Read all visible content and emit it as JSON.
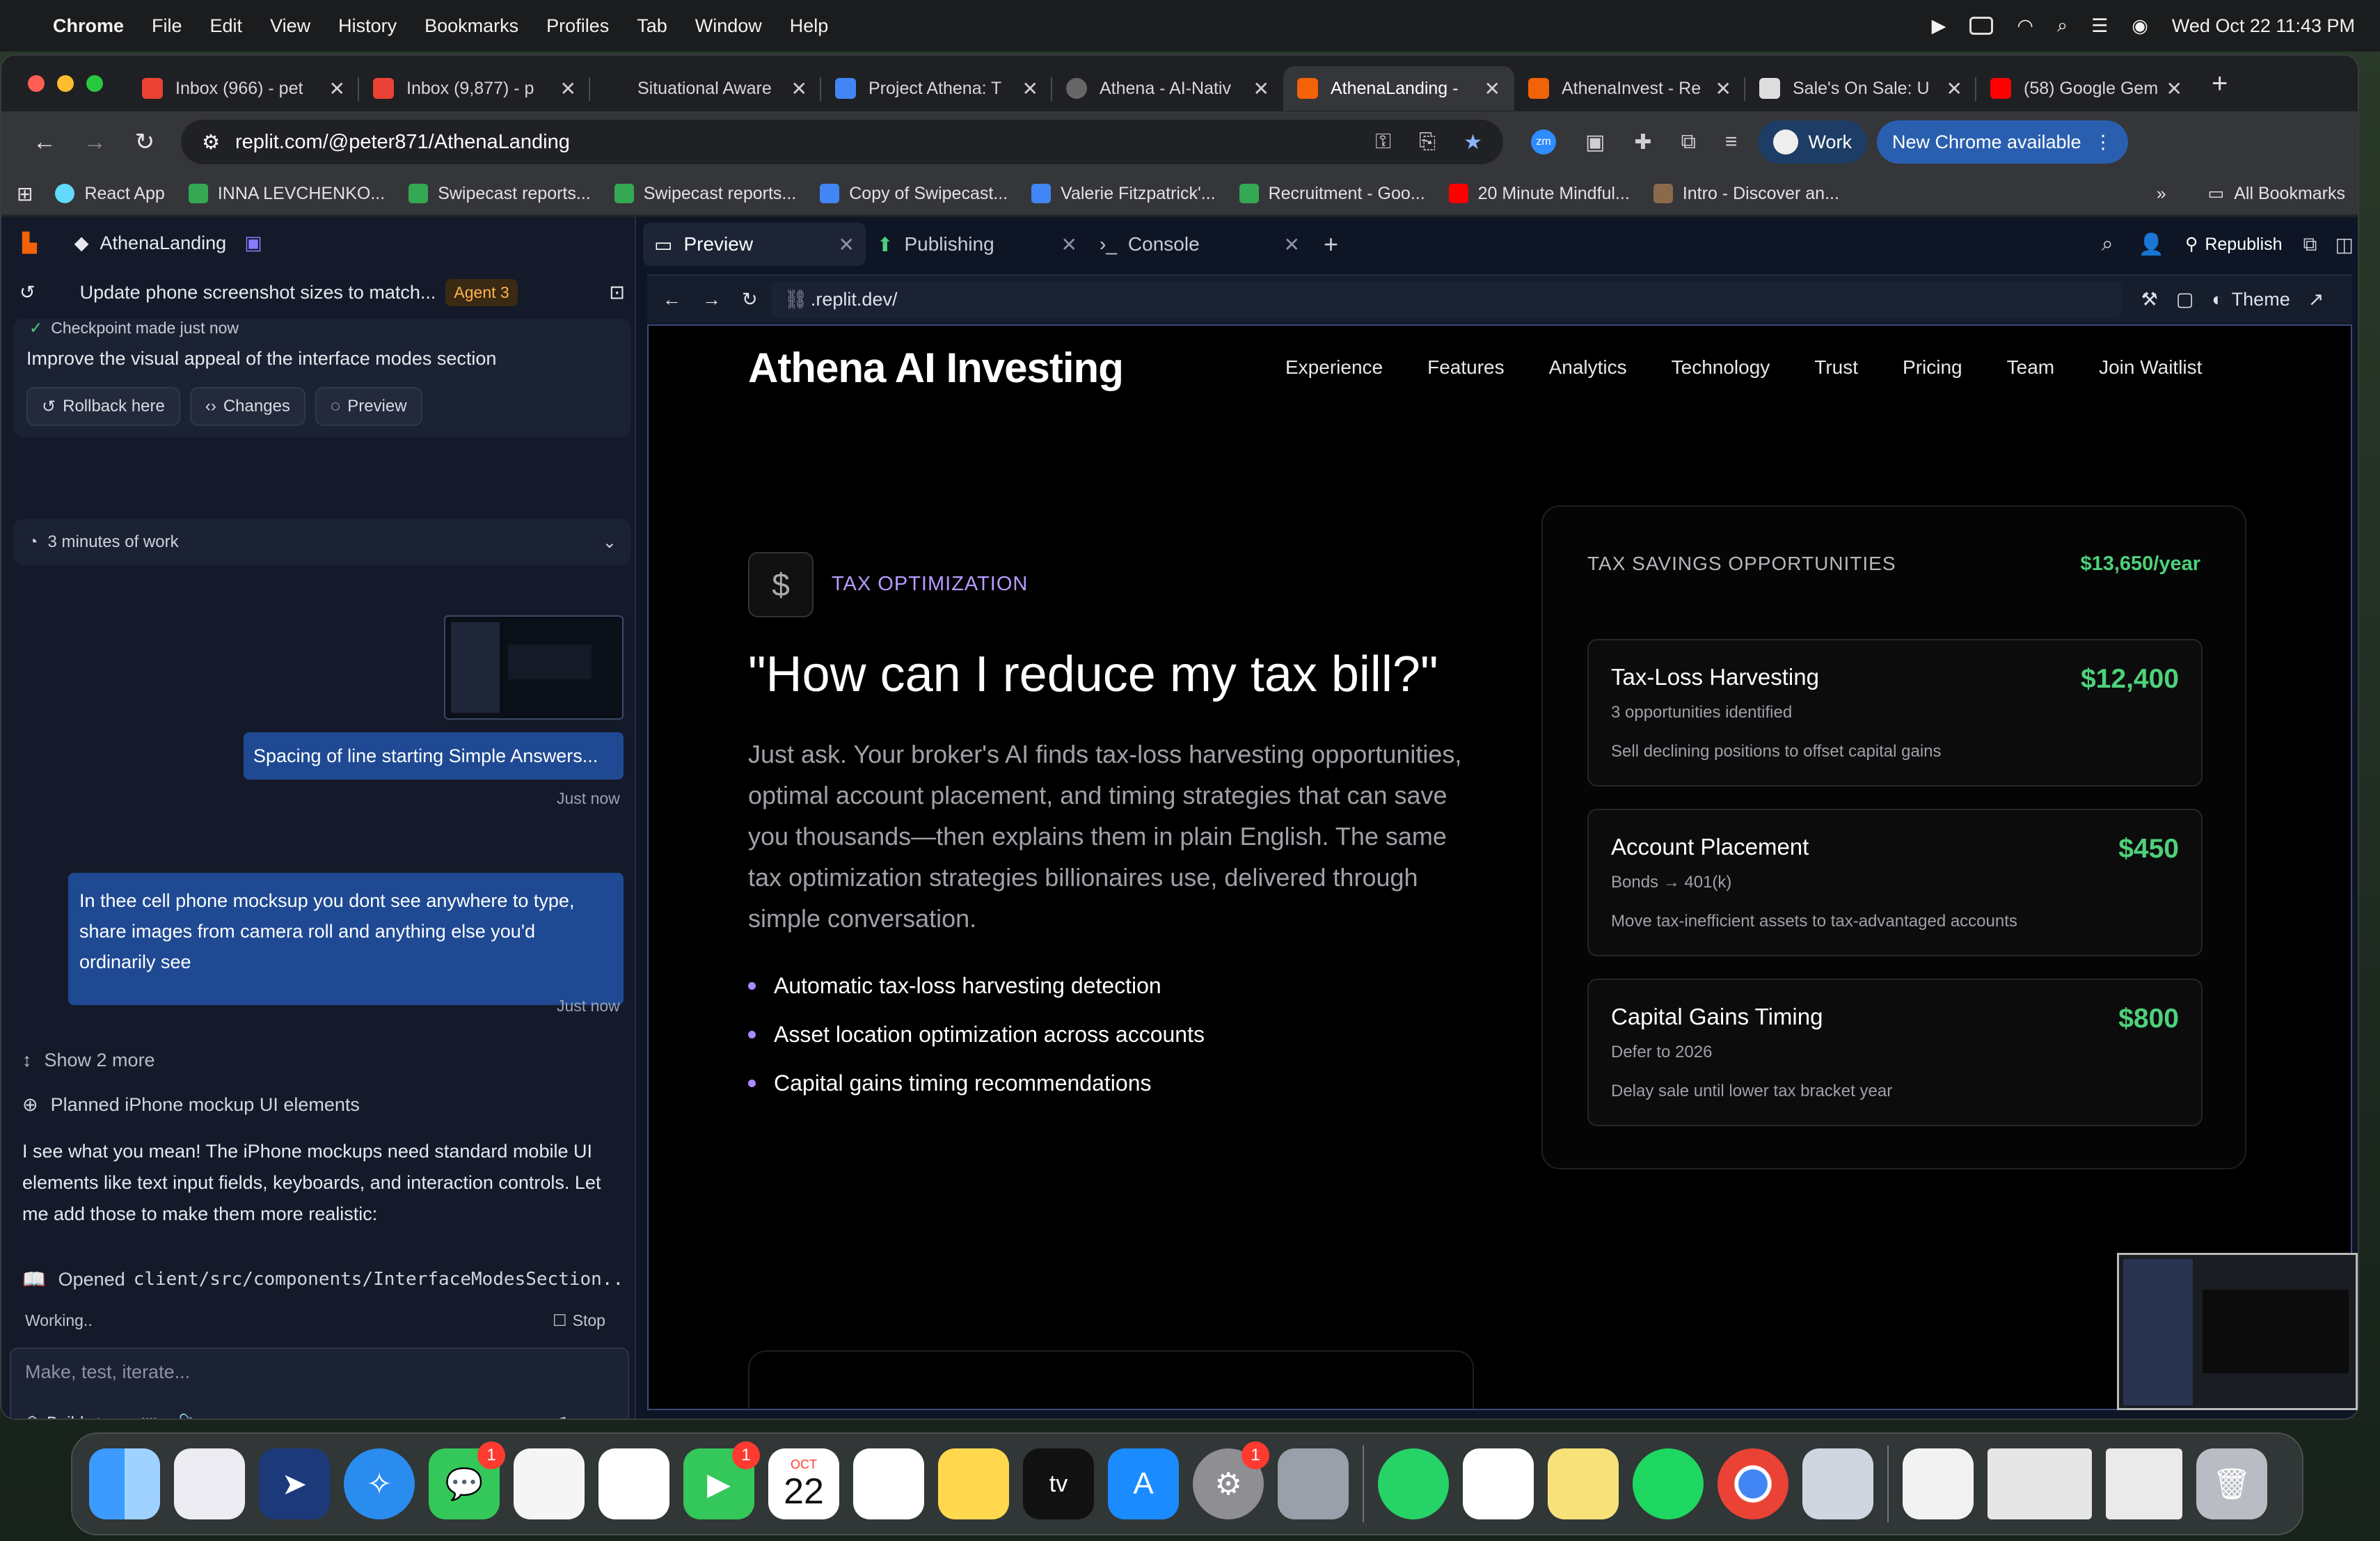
{
  "menubar": {
    "app": "Chrome",
    "items": [
      "File",
      "Edit",
      "View",
      "History",
      "Bookmarks",
      "Profiles",
      "Tab",
      "Window",
      "Help"
    ],
    "datetime": "Wed Oct 22  11:43 PM"
  },
  "tabs": [
    {
      "title": "Inbox (966) - pet",
      "color": "#ea4335"
    },
    {
      "title": "Inbox (9,877) - p",
      "color": "#ea4335"
    },
    {
      "title": "Situational Aware",
      "color": "#444"
    },
    {
      "title": "Project Athena: T",
      "color": "#4285f4"
    },
    {
      "title": "Athena - AI-Nativ",
      "color": "#777"
    },
    {
      "title": "AthenaLanding -",
      "color": "#f26207"
    },
    {
      "title": "AthenaInvest - Re",
      "color": "#f26207"
    },
    {
      "title": "Sale's On Sale: U",
      "color": "#ddd"
    },
    {
      "title": "(58) Google Gem",
      "color": "#ff0000"
    }
  ],
  "address": {
    "url": "replit.com/@peter871/AthenaLanding",
    "profile": "Work",
    "update": "New Chrome available"
  },
  "bookmarks": [
    {
      "label": "React App",
      "color": "#61dafb"
    },
    {
      "label": "INNA LEVCHENKO...",
      "color": "#34a853"
    },
    {
      "label": "Swipecast reports...",
      "color": "#34a853"
    },
    {
      "label": "Swipecast reports...",
      "color": "#34a853"
    },
    {
      "label": "Copy of Swipecast...",
      "color": "#4285f4"
    },
    {
      "label": "Valerie Fitzpatrick'...",
      "color": "#4285f4"
    },
    {
      "label": "Recruitment - Goo...",
      "color": "#34a853"
    },
    {
      "label": "20 Minute Mindful...",
      "color": "#ff0000"
    },
    {
      "label": "Intro - Discover an...",
      "color": "#8a6a4a"
    }
  ],
  "all_bookmarks": "All Bookmarks",
  "replit": {
    "project": "AthenaLanding",
    "task": "Update phone screenshot sizes to match...",
    "agent": "Agent 3",
    "checkpoint": "Checkpoint made just now",
    "checkpoint_desc": "Improve the visual appeal of the interface modes section",
    "rollback": "Rollback here",
    "changes": "Changes",
    "preview": "Preview",
    "work_time": "3 minutes of work",
    "msg1": "Spacing of line starting Simple Answers...",
    "msg1_time": "Just now",
    "msg2": "In thee cell phone mocksup you dont see anywhere to type, share images from camera roll and anything else you'd ordinarily see",
    "msg2_time": "Just now",
    "show_more": "Show 2 more",
    "planned": "Planned iPhone mockup UI elements",
    "reply": "I see what you mean! The iPhone mockups need standard mobile UI elements like text input fields, keyboards, and interaction controls. Let me add those to make them more realistic:",
    "opened_label": "Opened",
    "opened_path": "client/src/components/InterfaceModesSection...",
    "working": "Working..",
    "stop": "Stop",
    "placeholder": "Make, test, iterate...",
    "build": "Build",
    "ptabs": [
      "Preview",
      "Publishing",
      "Console"
    ],
    "republish": "Republish",
    "preview_url": ".replit.dev/",
    "theme": "Theme"
  },
  "site": {
    "logo": "Athena AI Investing",
    "nav": [
      "Experience",
      "Features",
      "Analytics",
      "Technology",
      "Trust",
      "Pricing",
      "Team",
      "Join Waitlist"
    ],
    "tag": "TAX OPTIMIZATION",
    "headline": "\"How can I reduce my tax bill?\"",
    "paragraph": "Just ask. Your broker's AI finds tax-loss harvesting opportunities, optimal account placement, and timing strategies that can save you thousands—then explains them in plain English. The same tax optimization strategies billionaires use, delivered through simple conversation.",
    "bullets": [
      "Automatic tax-loss harvesting detection",
      "Asset location optimization across accounts",
      "Capital gains timing recommendations"
    ],
    "card_title": "TAX SAVINGS OPPORTUNITIES",
    "card_total": "$13,650/year",
    "items": [
      {
        "name": "Tax-Loss Harvesting",
        "amount": "$12,400",
        "sub": "3 opportunities identified",
        "desc": "Sell declining positions to offset capital gains"
      },
      {
        "name": "Account Placement",
        "amount": "$450",
        "sub": "Bonds → 401(k)",
        "desc": "Move tax-inefficient assets to tax-advantaged accounts"
      },
      {
        "name": "Capital Gains Timing",
        "amount": "$800",
        "sub": "Defer to 2026",
        "desc": "Delay sale until lower tax bracket year"
      }
    ]
  },
  "dock": {
    "calendar_month": "OCT",
    "calendar_day": "22",
    "badge_messages": "1",
    "badge_facetime": "1",
    "badge_settings": "1"
  }
}
